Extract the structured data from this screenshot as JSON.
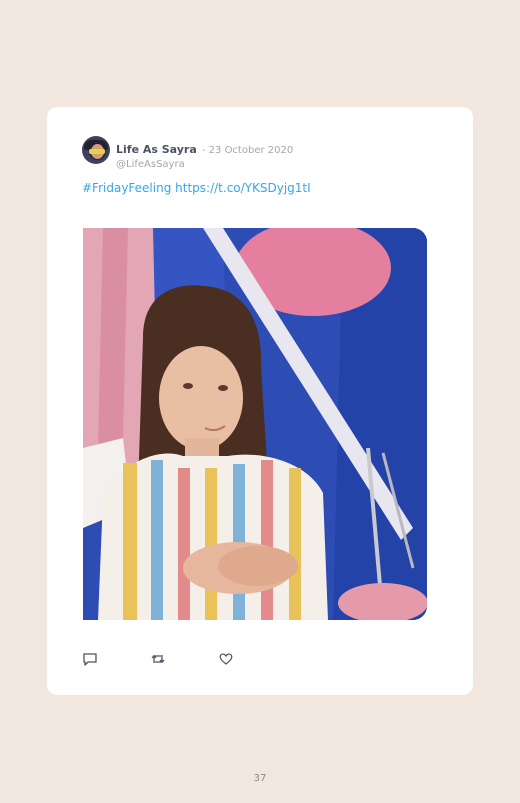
{
  "tweet": {
    "author_name": "Life As Sayra",
    "date": "- 23 October 2020",
    "handle": "@LifeAsSayra",
    "hashtag": "#FridayFeeling",
    "link": "https://t.co/YKSDyjg1tI"
  },
  "actions": {
    "reply_icon": "reply-icon",
    "retweet_icon": "retweet-icon",
    "like_icon": "heart-icon"
  },
  "colors": {
    "background": "#f2e7de",
    "card": "#ffffff",
    "link": "#35a6ea"
  },
  "page": {
    "number": "37"
  }
}
